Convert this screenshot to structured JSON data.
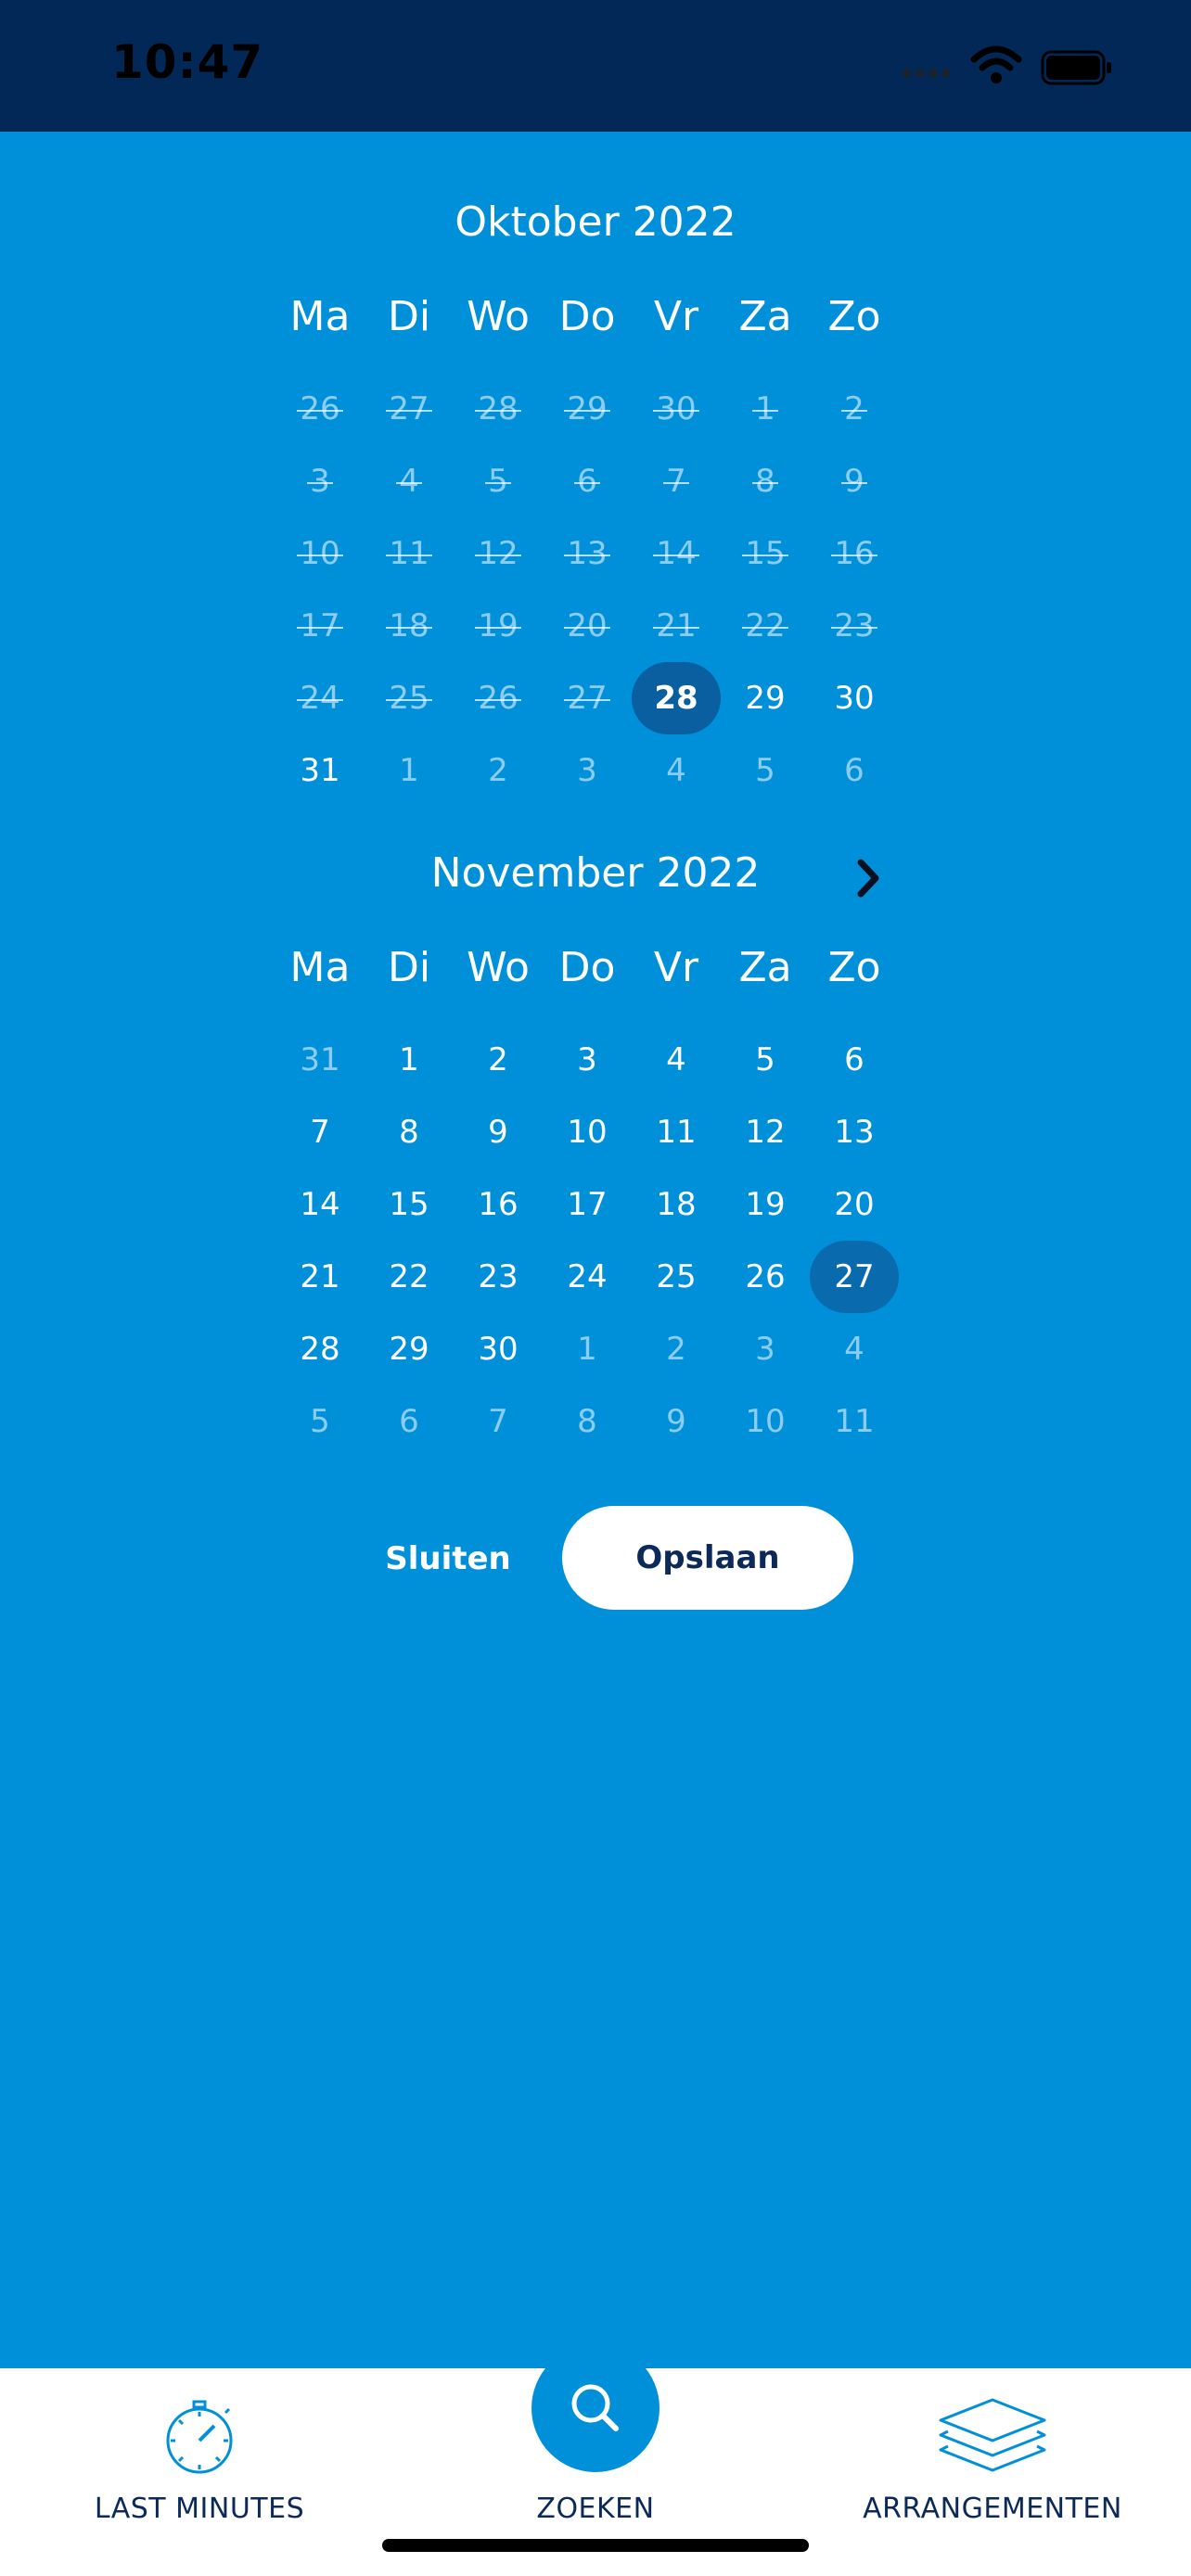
{
  "status_bar": {
    "time": "10:47"
  },
  "calendar": {
    "weekdays": [
      "Ma",
      "Di",
      "Wo",
      "Do",
      "Vr",
      "Za",
      "Zo"
    ],
    "months": [
      {
        "title": "Oktober 2022",
        "weeks": [
          [
            {
              "d": "26",
              "s": "past"
            },
            {
              "d": "27",
              "s": "past"
            },
            {
              "d": "28",
              "s": "past"
            },
            {
              "d": "29",
              "s": "past"
            },
            {
              "d": "30",
              "s": "past"
            },
            {
              "d": "1",
              "s": "past"
            },
            {
              "d": "2",
              "s": "past"
            }
          ],
          [
            {
              "d": "3",
              "s": "past"
            },
            {
              "d": "4",
              "s": "past"
            },
            {
              "d": "5",
              "s": "past"
            },
            {
              "d": "6",
              "s": "past"
            },
            {
              "d": "7",
              "s": "past"
            },
            {
              "d": "8",
              "s": "past"
            },
            {
              "d": "9",
              "s": "past"
            }
          ],
          [
            {
              "d": "10",
              "s": "past"
            },
            {
              "d": "11",
              "s": "past"
            },
            {
              "d": "12",
              "s": "past"
            },
            {
              "d": "13",
              "s": "past"
            },
            {
              "d": "14",
              "s": "past"
            },
            {
              "d": "15",
              "s": "past"
            },
            {
              "d": "16",
              "s": "past"
            }
          ],
          [
            {
              "d": "17",
              "s": "past"
            },
            {
              "d": "18",
              "s": "past"
            },
            {
              "d": "19",
              "s": "past"
            },
            {
              "d": "20",
              "s": "past"
            },
            {
              "d": "21",
              "s": "past"
            },
            {
              "d": "22",
              "s": "past"
            },
            {
              "d": "23",
              "s": "past"
            }
          ],
          [
            {
              "d": "24",
              "s": "past"
            },
            {
              "d": "25",
              "s": "past"
            },
            {
              "d": "26",
              "s": "past"
            },
            {
              "d": "27",
              "s": "past"
            },
            {
              "d": "28",
              "s": "selected"
            },
            {
              "d": "29",
              "s": "available"
            },
            {
              "d": "30",
              "s": "available"
            }
          ],
          [
            {
              "d": "31",
              "s": "available"
            },
            {
              "d": "1",
              "s": "other"
            },
            {
              "d": "2",
              "s": "other"
            },
            {
              "d": "3",
              "s": "other"
            },
            {
              "d": "4",
              "s": "other"
            },
            {
              "d": "5",
              "s": "other"
            },
            {
              "d": "6",
              "s": "other"
            }
          ]
        ]
      },
      {
        "title": "November 2022",
        "weeks": [
          [
            {
              "d": "31",
              "s": "other"
            },
            {
              "d": "1",
              "s": "available"
            },
            {
              "d": "2",
              "s": "available"
            },
            {
              "d": "3",
              "s": "available"
            },
            {
              "d": "4",
              "s": "available"
            },
            {
              "d": "5",
              "s": "available"
            },
            {
              "d": "6",
              "s": "available"
            }
          ],
          [
            {
              "d": "7",
              "s": "available"
            },
            {
              "d": "8",
              "s": "available"
            },
            {
              "d": "9",
              "s": "available"
            },
            {
              "d": "10",
              "s": "available"
            },
            {
              "d": "11",
              "s": "available"
            },
            {
              "d": "12",
              "s": "available"
            },
            {
              "d": "13",
              "s": "available"
            }
          ],
          [
            {
              "d": "14",
              "s": "available"
            },
            {
              "d": "15",
              "s": "available"
            },
            {
              "d": "16",
              "s": "available"
            },
            {
              "d": "17",
              "s": "available"
            },
            {
              "d": "18",
              "s": "available"
            },
            {
              "d": "19",
              "s": "available"
            },
            {
              "d": "20",
              "s": "available"
            }
          ],
          [
            {
              "d": "21",
              "s": "available"
            },
            {
              "d": "22",
              "s": "available"
            },
            {
              "d": "23",
              "s": "available"
            },
            {
              "d": "24",
              "s": "available"
            },
            {
              "d": "25",
              "s": "available"
            },
            {
              "d": "26",
              "s": "available"
            },
            {
              "d": "27",
              "s": "range-end"
            }
          ],
          [
            {
              "d": "28",
              "s": "available"
            },
            {
              "d": "29",
              "s": "available"
            },
            {
              "d": "30",
              "s": "available"
            },
            {
              "d": "1",
              "s": "other"
            },
            {
              "d": "2",
              "s": "other"
            },
            {
              "d": "3",
              "s": "other"
            },
            {
              "d": "4",
              "s": "other"
            }
          ],
          [
            {
              "d": "5",
              "s": "other"
            },
            {
              "d": "6",
              "s": "other"
            },
            {
              "d": "7",
              "s": "other"
            },
            {
              "d": "8",
              "s": "other"
            },
            {
              "d": "9",
              "s": "other"
            },
            {
              "d": "10",
              "s": "other"
            },
            {
              "d": "11",
              "s": "other"
            }
          ]
        ]
      }
    ],
    "next_icon": "chevron-right-icon"
  },
  "actions": {
    "close_label": "Sluiten",
    "save_label": "Opslaan"
  },
  "tab_bar": {
    "last_minutes": {
      "label": "LAST MINUTES",
      "icon": "stopwatch-icon"
    },
    "search": {
      "label": "ZOEKEN",
      "icon": "search-icon"
    },
    "arrangements": {
      "label": "ARRANGEMENTEN",
      "icon": "layers-icon"
    }
  },
  "colors": {
    "background": "#0090DA",
    "status_bar": "#022858",
    "selected_day": "#0A5FA0",
    "navy_text": "#0B2A5A",
    "tab_bar": "#FFFFFF"
  }
}
